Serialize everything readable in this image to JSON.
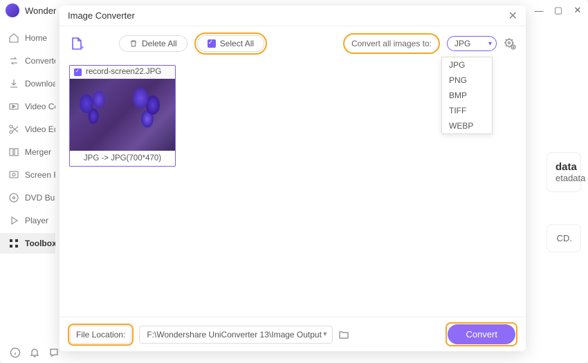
{
  "titlebar": {
    "brand": "Wonder"
  },
  "sidebar": {
    "items": [
      {
        "label": "Home"
      },
      {
        "label": "Converte"
      },
      {
        "label": "Downloa"
      },
      {
        "label": "Video Co"
      },
      {
        "label": "Video Ed"
      },
      {
        "label": "Merger"
      },
      {
        "label": "Screen R"
      },
      {
        "label": "DVD Bur"
      },
      {
        "label": "Player"
      },
      {
        "label": "Toolbox"
      }
    ]
  },
  "modal": {
    "title": "Image Converter",
    "delete_all": "Delete All",
    "select_all": "Select All",
    "convert_all_label": "Convert all images to:",
    "format_selected": "JPG",
    "format_options": [
      "JPG",
      "PNG",
      "BMP",
      "TIFF",
      "WEBP"
    ],
    "thumbnail": {
      "filename": "record-screen22.JPG",
      "conversion": "JPG -> JPG(700*470)"
    },
    "footer": {
      "file_location_label": "File Location:",
      "file_path": "F:\\Wondershare UniConverter 13\\Image Output",
      "convert_label": "Convert"
    }
  },
  "right_cards": {
    "metadata_header": "data",
    "metadata_sub": "etadata",
    "cd_hint": "CD."
  }
}
